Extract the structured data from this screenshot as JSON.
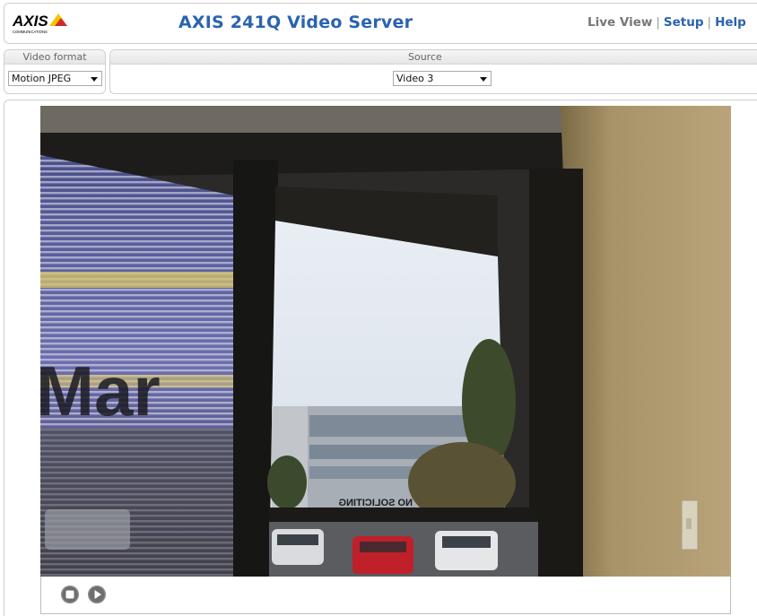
{
  "header": {
    "logo_text": "AXIS",
    "logo_subtext": "COMMUNICATIONS",
    "title": "AXIS 241Q Video Server",
    "nav": {
      "live_view": "Live View",
      "separator": "|",
      "setup": "Setup",
      "help": "Help"
    }
  },
  "controls": {
    "video_format": {
      "label": "Video format",
      "value": "Motion JPEG"
    },
    "source": {
      "label": "Source",
      "value": "Video 3"
    }
  },
  "video": {
    "camera_view_text": "NO SOLICITING",
    "window_lettering": "Mar"
  },
  "player": {
    "stop_icon": "stop-icon",
    "play_icon": "play-icon"
  },
  "colors": {
    "brand_blue": "#2a63b0",
    "logo_yellow": "#f6c600",
    "logo_red": "#d0282e",
    "border": "#cfcfcf"
  }
}
